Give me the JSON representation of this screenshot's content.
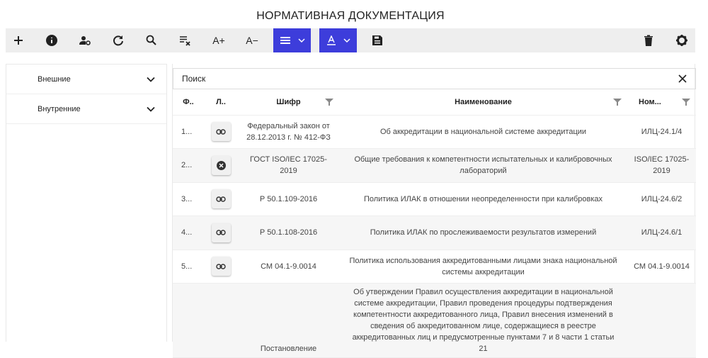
{
  "title": "НОРМАТИВНАЯ ДОКУМЕНТАЦИЯ",
  "toolbar": {
    "icons": [
      "plus-icon",
      "info-icon",
      "user-settings-icon",
      "refresh-icon",
      "search-icon",
      "clear-filter-icon",
      "font-increase-icon",
      "font-decrease-icon",
      "align-menu",
      "text-color-menu",
      "save-icon",
      "trash-icon",
      "gear-icon"
    ],
    "font_plus": "A+",
    "font_minus": "A−",
    "accent": "#3d3ddb"
  },
  "sidebar": {
    "items": [
      {
        "label": "Внешние"
      },
      {
        "label": "Внутренние"
      }
    ]
  },
  "search": {
    "placeholder": "Поиск"
  },
  "table": {
    "headers": [
      "Ф..",
      "Л..",
      "Шифр",
      "Наименование",
      "Ном..."
    ],
    "rows": [
      {
        "num": "1...",
        "link": "link",
        "code": "Федеральный закон от 28.12.2013 г. № 412-ФЗ",
        "name": "Об аккредитации в национальной системе аккредитации",
        "nom": "ИЛЦ-24.1/4"
      },
      {
        "num": "2...",
        "link": "none",
        "code": "ГОСТ ISO/IEC 17025-2019",
        "name": "Общие требования к компетентности испытательных и калибровочных лабораторий",
        "nom": "ISO/IEC 17025-2019"
      },
      {
        "num": "3...",
        "link": "link",
        "code": "Р 50.1.109-2016",
        "name": "Политика ИЛАК в отношении неопределенности при калибровках",
        "nom": "ИЛЦ-24.6/2"
      },
      {
        "num": "4...",
        "link": "link",
        "code": "Р 50.1.108-2016",
        "name": "Политика ИЛАК по прослеживаемости результатов измерений",
        "nom": "ИЛЦ-24.6/1"
      },
      {
        "num": "5...",
        "link": "link",
        "code": "СМ 04.1-9.0014",
        "name": "Политика использования аккредитованными лицами знака национальной системы аккредитации",
        "nom": "СМ 04.1-9.0014"
      },
      {
        "num": "",
        "link": "",
        "code": "Постановление",
        "name": "Об утверждении Правил осуществления аккредитации в национальной системе аккредитации, Правил проведения процедуры подтверждения компетентности аккредитованного лица, Правил внесения изменений в сведения об аккредитованном лице, содержащиеся в реестре аккредитованных лиц и предусмотренные пунктами 7 и 8 части 1 статьи 21",
        "nom": ""
      }
    ]
  }
}
